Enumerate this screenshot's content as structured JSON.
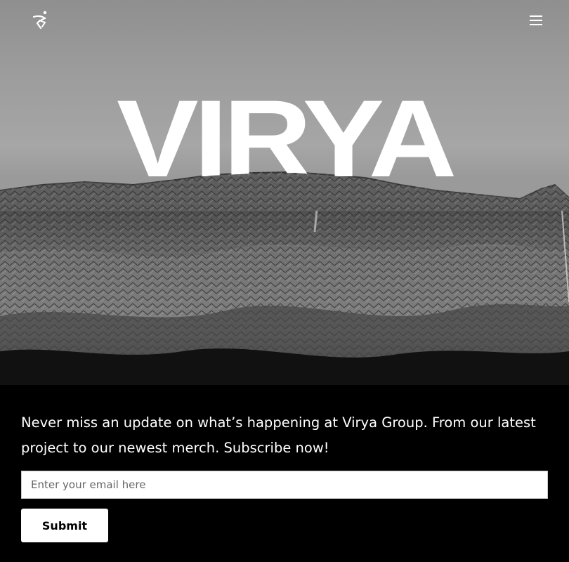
{
  "header": {
    "logo_icon": "dancing-figure-logo-icon",
    "menu_icon": "hamburger-menu-icon"
  },
  "hero": {
    "title": "VIRYA"
  },
  "newsletter": {
    "message": "Never miss an update on what’s happening at Virya Group. From our latest project to our newest merch. Subscribe now!",
    "email_placeholder": "Enter your email here",
    "submit_label": "Submit"
  }
}
